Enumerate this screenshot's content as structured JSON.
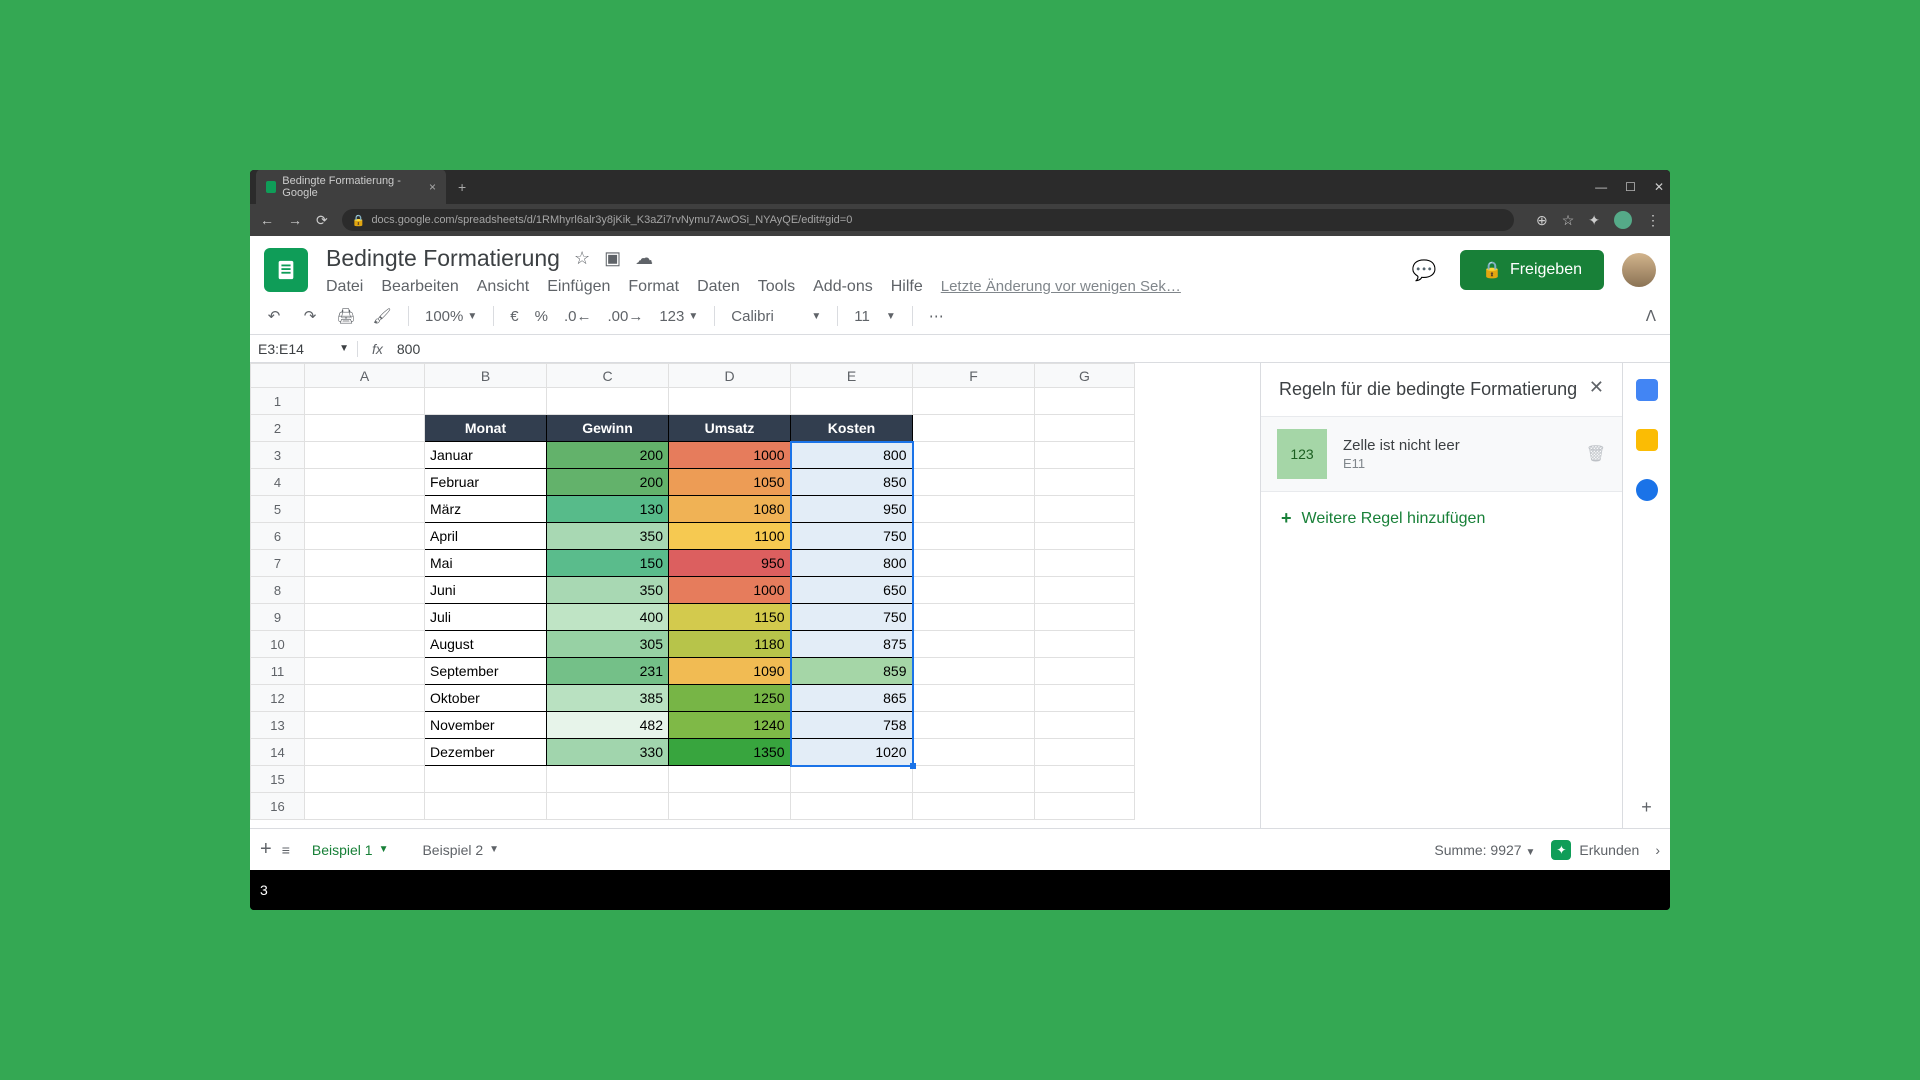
{
  "browser": {
    "tab_title": "Bedingte Formatierung - Google",
    "url": "docs.google.com/spreadsheets/d/1RMhyrl6alr3y8jKik_K3aZi7rvNymu7AwOSi_NYAyQE/edit#gid=0"
  },
  "doc": {
    "title": "Bedingte Formatierung",
    "menus": [
      "Datei",
      "Bearbeiten",
      "Ansicht",
      "Einfügen",
      "Format",
      "Daten",
      "Tools",
      "Add-ons",
      "Hilfe"
    ],
    "last_edit": "Letzte Änderung vor wenigen Sek…",
    "share_label": "Freigeben"
  },
  "toolbar": {
    "zoom": "100%",
    "currency": "€",
    "percent": "%",
    "dec_dec": ".0",
    "dec_inc": ".00",
    "numfmt": "123",
    "font": "Calibri",
    "font_size": "11"
  },
  "formula": {
    "namebox": "E3:E14",
    "value": "800"
  },
  "columns": [
    "A",
    "B",
    "C",
    "D",
    "E",
    "F",
    "G"
  ],
  "row_numbers": [
    1,
    2,
    3,
    4,
    5,
    6,
    7,
    8,
    9,
    10,
    11,
    12,
    13,
    14,
    15,
    16
  ],
  "headers": {
    "monat": "Monat",
    "gewinn": "Gewinn",
    "umsatz": "Umsatz",
    "kosten": "Kosten"
  },
  "rows": [
    {
      "b": "Januar",
      "c": 200,
      "d": 1000,
      "e": 800,
      "c_bg": "#63b26b",
      "d_bg": "#e67c5c"
    },
    {
      "b": "Februar",
      "c": 200,
      "d": 1050,
      "e": 850,
      "c_bg": "#63b26b",
      "d_bg": "#ed9c55"
    },
    {
      "b": "März",
      "c": 130,
      "d": 1080,
      "e": 950,
      "c_bg": "#57bb8a",
      "d_bg": "#f0b255"
    },
    {
      "b": "April",
      "c": 350,
      "d": 1100,
      "e": 750,
      "c_bg": "#a8d8b3",
      "d_bg": "#f6c951"
    },
    {
      "b": "Mai",
      "c": 150,
      "d": 950,
      "e": 800,
      "c_bg": "#5abc8c",
      "d_bg": "#dc5f5f"
    },
    {
      "b": "Juni",
      "c": 350,
      "d": 1000,
      "e": 650,
      "c_bg": "#a8d8b3",
      "d_bg": "#e67c5c"
    },
    {
      "b": "Juli",
      "c": 400,
      "d": 1150,
      "e": 750,
      "c_bg": "#bfe4c5",
      "d_bg": "#d3ca4d"
    },
    {
      "b": "August",
      "c": 305,
      "d": 1180,
      "e": 875,
      "c_bg": "#97d1a4",
      "d_bg": "#b7c44a"
    },
    {
      "b": "September",
      "c": 231,
      "d": 1090,
      "e": 859,
      "c_bg": "#74c088",
      "d_bg": "#f1bb53",
      "e_bg": "#a5d6a7"
    },
    {
      "b": "Oktober",
      "c": 385,
      "d": 1250,
      "e": 865,
      "c_bg": "#b9e1c1",
      "d_bg": "#77b546"
    },
    {
      "b": "November",
      "c": 482,
      "d": 1240,
      "e": 758,
      "c_bg": "#e7f4ea",
      "d_bg": "#7fb947"
    },
    {
      "b": "Dezember",
      "c": 330,
      "d": 1350,
      "e": 1020,
      "c_bg": "#a1d5ad",
      "d_bg": "#38a53e"
    }
  ],
  "sidepanel": {
    "title": "Regeln für die bedingte Formatierung",
    "rule_preview": "123",
    "rule_name": "Zelle ist nicht leer",
    "rule_range": "E11",
    "add_rule": "Weitere Regel hinzufügen"
  },
  "footer": {
    "sheets": [
      "Beispiel 1",
      "Beispiel 2"
    ],
    "summary": "Summe: 9927",
    "explore": "Erkunden"
  },
  "overlay_number": "3",
  "chart_data": {
    "type": "table",
    "title": "Bedingte Formatierung",
    "columns": [
      "Monat",
      "Gewinn",
      "Umsatz",
      "Kosten"
    ],
    "rows": [
      [
        "Januar",
        200,
        1000,
        800
      ],
      [
        "Februar",
        200,
        1050,
        850
      ],
      [
        "März",
        130,
        1080,
        950
      ],
      [
        "April",
        350,
        1100,
        750
      ],
      [
        "Mai",
        150,
        950,
        800
      ],
      [
        "Juni",
        350,
        1000,
        650
      ],
      [
        "Juli",
        400,
        1150,
        750
      ],
      [
        "August",
        305,
        1180,
        875
      ],
      [
        "September",
        231,
        1090,
        859
      ],
      [
        "Oktober",
        385,
        1250,
        865
      ],
      [
        "November",
        482,
        1240,
        758
      ],
      [
        "Dezember",
        330,
        1350,
        1020
      ]
    ]
  }
}
